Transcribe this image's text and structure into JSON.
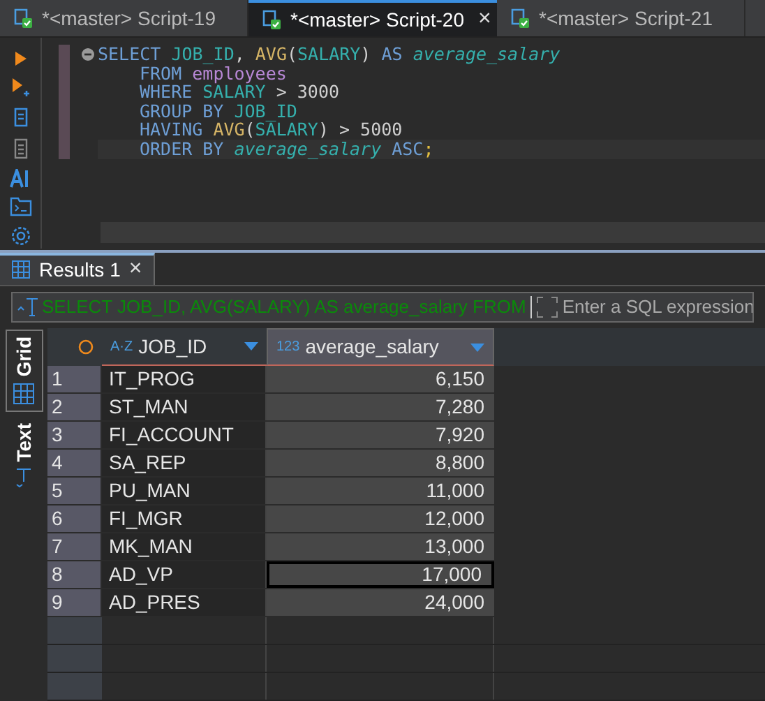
{
  "editor_tabs": [
    {
      "label": "*<master> Script-19",
      "selected": false
    },
    {
      "label": "*<master> Script-20",
      "selected": true,
      "close": "×"
    },
    {
      "label": "*<master> Script-21",
      "selected": false
    }
  ],
  "sql_lines": [
    [
      {
        "kind": "keyword",
        "text": "SELECT "
      },
      {
        "kind": "column",
        "text": "JOB_ID"
      },
      {
        "kind": "plain",
        "text": ", "
      },
      {
        "kind": "function",
        "text": "AVG"
      },
      {
        "kind": "plain",
        "text": "("
      },
      {
        "kind": "column",
        "text": "SALARY"
      },
      {
        "kind": "plain",
        "text": ") "
      },
      {
        "kind": "keyword",
        "text": "AS "
      },
      {
        "kind": "alias",
        "text": "average_salary"
      }
    ],
    [
      {
        "kind": "keyword",
        "text": "FROM "
      },
      {
        "kind": "table",
        "text": "employees"
      }
    ],
    [
      {
        "kind": "keyword",
        "text": "WHERE "
      },
      {
        "kind": "column",
        "text": "SALARY"
      },
      {
        "kind": "plain",
        "text": " > 3000"
      }
    ],
    [
      {
        "kind": "keyword",
        "text": "GROUP BY "
      },
      {
        "kind": "column",
        "text": "JOB_ID"
      }
    ],
    [
      {
        "kind": "keyword",
        "text": "HAVING "
      },
      {
        "kind": "function",
        "text": "AVG"
      },
      {
        "kind": "plain",
        "text": "("
      },
      {
        "kind": "column",
        "text": "SALARY"
      },
      {
        "kind": "plain",
        "text": ") > 5000"
      }
    ],
    [
      {
        "kind": "keyword",
        "text": "ORDER BY "
      },
      {
        "kind": "alias",
        "text": "average_salary"
      },
      {
        "kind": "keyword",
        "text": " ASC"
      },
      {
        "kind": "punct",
        "text": ";"
      }
    ]
  ],
  "results_tab": {
    "label": "Results 1",
    "close": "×"
  },
  "filter": {
    "query": "SELECT JOB_ID, AVG(SALARY) AS average_salary FROM",
    "placeholder": "Enter a SQL expression"
  },
  "view_tabs": [
    {
      "label": "Grid",
      "selected": true
    },
    {
      "label": "Text",
      "selected": false
    }
  ],
  "table": {
    "columns": [
      {
        "type_label": "A·Z",
        "name": "JOB_ID"
      },
      {
        "type_label": "123",
        "name": "average_salary"
      }
    ],
    "rows": [
      {
        "num": "1",
        "job_id": "IT_PROG",
        "average_salary": "6,150",
        "selected": false
      },
      {
        "num": "2",
        "job_id": "ST_MAN",
        "average_salary": "7,280",
        "selected": false
      },
      {
        "num": "3",
        "job_id": "FI_ACCOUNT",
        "average_salary": "7,920",
        "selected": false
      },
      {
        "num": "4",
        "job_id": "SA_REP",
        "average_salary": "8,800",
        "selected": false
      },
      {
        "num": "5",
        "job_id": "PU_MAN",
        "average_salary": "11,000",
        "selected": false
      },
      {
        "num": "6",
        "job_id": "FI_MGR",
        "average_salary": "12,000",
        "selected": false
      },
      {
        "num": "7",
        "job_id": "MK_MAN",
        "average_salary": "13,000",
        "selected": false
      },
      {
        "num": "8",
        "job_id": "AD_VP",
        "average_salary": "17,000",
        "selected": true
      },
      {
        "num": "9",
        "job_id": "AD_PRES",
        "average_salary": "24,000",
        "selected": false
      }
    ]
  }
}
